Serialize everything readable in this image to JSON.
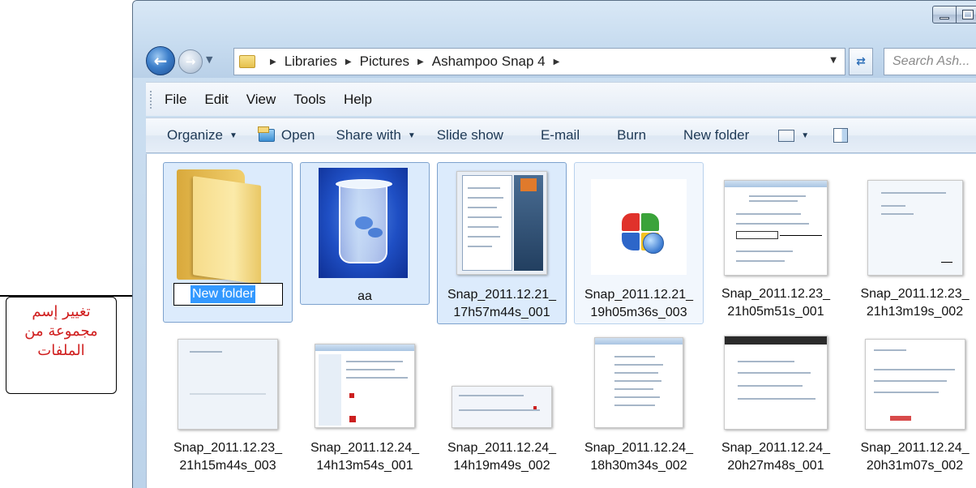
{
  "window": {
    "minimize_label": "",
    "maximize_label": ""
  },
  "address": {
    "crumbs": [
      "Libraries",
      "Pictures",
      "Ashampoo Snap 4"
    ],
    "search_placeholder": "Search Ash..."
  },
  "menubar": {
    "items": [
      "File",
      "Edit",
      "View",
      "Tools",
      "Help"
    ]
  },
  "toolbar": {
    "organize": "Organize",
    "open": "Open",
    "share_with": "Share with",
    "slide_show": "Slide show",
    "email": "E-mail",
    "burn": "Burn",
    "new_folder": "New folder"
  },
  "items": [
    {
      "name": "New folder",
      "type": "folder-renaming"
    },
    {
      "name": "aa",
      "type": "image-recycle"
    },
    {
      "line1": "Snap_2011.12.21_",
      "line2": "17h57m44s_001"
    },
    {
      "line1": "Snap_2011.12.21_",
      "line2": "19h05m36s_003"
    },
    {
      "line1": "Snap_2011.12.23_",
      "line2": "21h05m51s_001"
    },
    {
      "line1": "Snap_2011.12.23_",
      "line2": "21h13m19s_002"
    },
    {
      "line1": "Snap_2011.12.23_",
      "line2": "21h15m44s_003"
    },
    {
      "line1": "Snap_2011.12.24_",
      "line2": "14h13m54s_001"
    },
    {
      "line1": "Snap_2011.12.24_",
      "line2": "14h19m49s_002"
    },
    {
      "line1": "Snap_2011.12.24_",
      "line2": "18h30m34s_002"
    },
    {
      "line1": "Snap_2011.12.24_",
      "line2": "20h27m48s_001"
    },
    {
      "line1": "Snap_2011.12.24_",
      "line2": "20h31m07s_002"
    }
  ],
  "annotation": {
    "text": "تغيير إسم\nمجموعة من\nالملفات"
  },
  "colors": {
    "selection": "#dcebfc",
    "rename_highlight": "#3399ff",
    "annotation_text": "#d01e1e"
  }
}
